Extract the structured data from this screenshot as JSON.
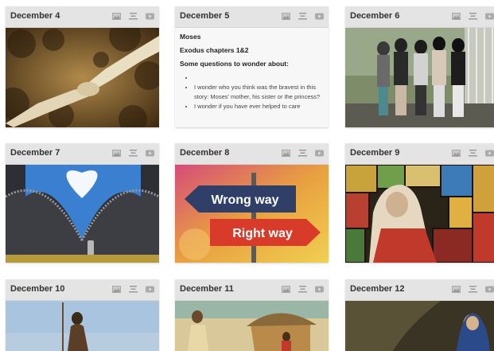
{
  "cards": [
    {
      "title": "December 4",
      "image": "hands-reaching-image"
    },
    {
      "title": "December 5",
      "text": {
        "name": "Moses",
        "reading": "Exodus chapters 1&2",
        "prompt": "Some questions to wonder about:",
        "bullets": [
          "",
          "I wonder who you think was the bravest in this story: Moses' mother, his sister or the princess?",
          "I wonder if you have ever helped to care"
        ]
      }
    },
    {
      "title": "December 6",
      "image": "group-of-women-photo"
    },
    {
      "title": "December 7",
      "image": "zipper-sky-heart-cloud-image"
    },
    {
      "title": "December 8",
      "image": "wrong-way-right-way-signs-image",
      "signs": {
        "wrong": "Wrong way",
        "right": "Right way"
      }
    },
    {
      "title": "December 9",
      "image": "stained-glass-woman-image"
    },
    {
      "title": "December 10",
      "image": "prophet-figure-image"
    },
    {
      "title": "December 11",
      "image": "village-painting-image"
    },
    {
      "title": "December 12",
      "image": "dark-painting-image"
    }
  ],
  "header_icons": [
    "image-icon",
    "align-icon",
    "video-icon"
  ],
  "colors": {
    "header_bg": "#e4e4e4",
    "card_bg": "#f0f0f0",
    "title_text": "#333333"
  }
}
